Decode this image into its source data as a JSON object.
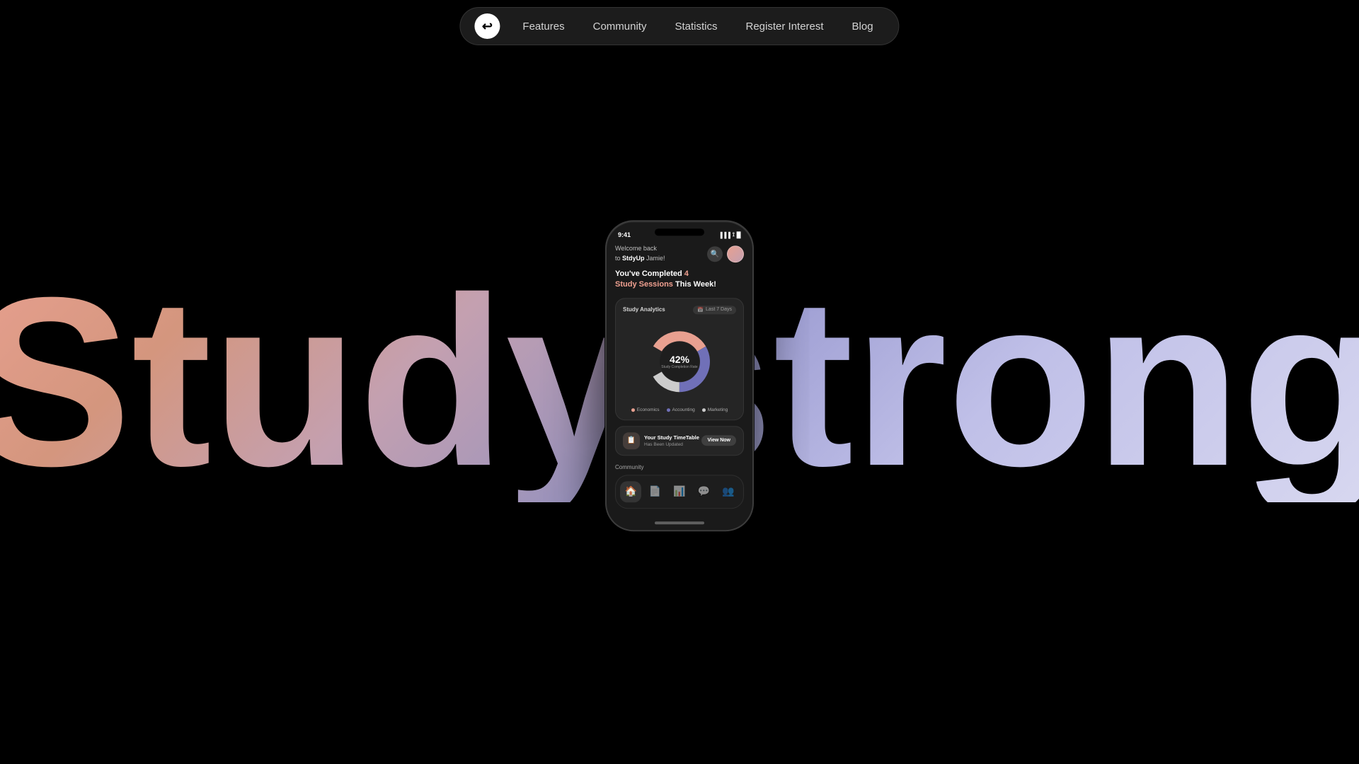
{
  "nav": {
    "logo": "↩",
    "links": [
      {
        "label": "Features",
        "name": "features"
      },
      {
        "label": "Community",
        "name": "community"
      },
      {
        "label": "Statistics",
        "name": "statistics"
      },
      {
        "label": "Register Interest",
        "name": "register-interest"
      },
      {
        "label": "Blog",
        "name": "blog"
      }
    ]
  },
  "background_text": {
    "study": "Study",
    "strong": "strong"
  },
  "phone": {
    "status_bar": {
      "time": "9:41",
      "signal": "▐▐▐",
      "wifi": "WiFi",
      "battery": "🔋"
    },
    "welcome": {
      "line1": "Welcome back",
      "line2_prefix": "to StdyUp",
      "line2_suffix": " Jamie!",
      "brand": "StdyUp"
    },
    "sessions": {
      "completed_prefix": "You've Completed ",
      "count": "4",
      "line2_prefix": "Study Sessions",
      "line2_suffix": " This Week!"
    },
    "analytics": {
      "title": "Study Analytics",
      "filter": "Last 7 Days",
      "percent": "42%",
      "label": "Study Completion Rate",
      "legend": [
        {
          "name": "Economics",
          "color": "#e8a090"
        },
        {
          "name": "Accounting",
          "color": "#9090c8"
        },
        {
          "name": "Marketing",
          "color": "#ffffff"
        }
      ],
      "chart": {
        "economics_deg": 150,
        "accounting_deg": 120,
        "marketing_deg": 60,
        "gap_deg": 30
      }
    },
    "timetable": {
      "title": "Your Study TimeTable",
      "subtitle": "Has Been Updated",
      "button": "View Now"
    },
    "community": {
      "title": "Community"
    },
    "bottom_nav": [
      {
        "icon": "🏠",
        "active": true,
        "name": "home"
      },
      {
        "icon": "📄",
        "active": false,
        "name": "documents"
      },
      {
        "icon": "📊",
        "active": false,
        "name": "stats"
      },
      {
        "icon": "💬",
        "active": false,
        "name": "chat"
      },
      {
        "icon": "👥",
        "active": false,
        "name": "community"
      }
    ]
  }
}
